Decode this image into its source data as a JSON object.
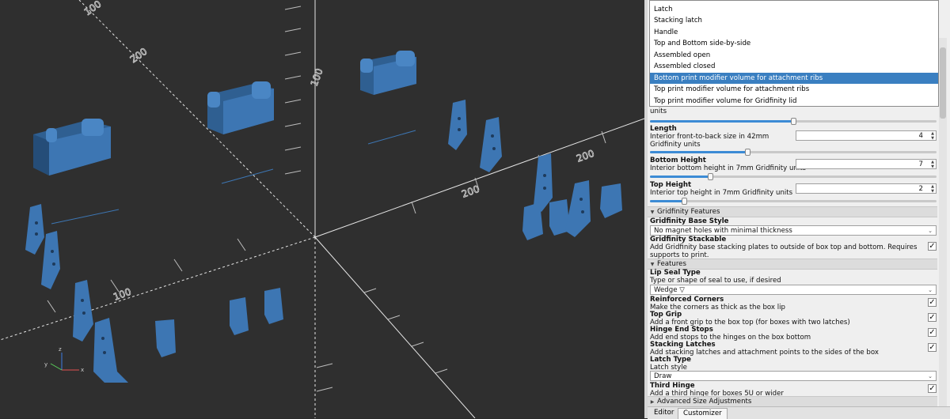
{
  "dropdown": {
    "options": [
      "Latch",
      "Stacking latch",
      "Handle",
      "Top and Bottom side-by-side",
      "Assembled open",
      "Assembled closed",
      "Bottom print modifier volume for attachment ribs",
      "Top print modifier volume for attachment ribs",
      "Top print modifier volume for Gridfinity lid"
    ],
    "selected_index": 6
  },
  "params": {
    "width": {
      "desc": "units",
      "slider": 0.5
    },
    "length": {
      "name": "Length",
      "desc": "Interior front-to-back size in 42mm Gridfinity units",
      "value": "4",
      "slider": 0.34
    },
    "bottom_height": {
      "name": "Bottom Height",
      "desc": "Interior bottom height in 7mm Gridfinity units",
      "value": "7",
      "slider": 0.21
    },
    "top_height": {
      "name": "Top Height",
      "desc": "Interior top height in 7mm Gridfinity units",
      "value": "2",
      "slider": 0.12
    }
  },
  "groups": {
    "gridfinity": "Gridfinity Features",
    "features": "Features",
    "advanced": "Advanced Size Adjustments"
  },
  "gridfinity": {
    "base_style_name": "Gridfinity Base Style",
    "base_style_value": "No magnet holes with minimal thickness",
    "stackable_name": "Gridfinity Stackable",
    "stackable_desc": "Add Gridfinity base stacking plates to outside of box top and bottom. Requires supports to print.",
    "stackable_checked": true
  },
  "features": {
    "lip_seal_name": "Lip Seal Type",
    "lip_seal_desc": "Type or shape of seal to use, if desired",
    "lip_seal_value": "Wedge ▽",
    "items": [
      {
        "name": "Reinforced Corners",
        "desc": "Make the corners as thick as the box lip",
        "checked": true
      },
      {
        "name": "Top Grip",
        "desc": "Add a front grip to the box top (for boxes with two latches)",
        "checked": true
      },
      {
        "name": "Hinge End Stops",
        "desc": "Add end stops to the hinges on the box bottom",
        "checked": true
      },
      {
        "name": "Stacking Latches",
        "desc": "Add stacking latches and attachment points to the sides of the box",
        "checked": true
      }
    ],
    "latch_type_name": "Latch Type",
    "latch_type_desc": "Latch style",
    "latch_type_value": "Draw",
    "third_hinge_name": "Third Hinge",
    "third_hinge_desc": "Add a third hinge for boxes 5U or wider",
    "third_hinge_checked": true
  },
  "tabs": [
    "Editor",
    "Customizer"
  ],
  "active_tab": 1,
  "viewport": {
    "axis_labels": [
      "100",
      "200",
      "100",
      "200",
      "100",
      "200",
      "z",
      "y",
      "x"
    ],
    "colors": {
      "background": "#2f2f2f",
      "part": "#3d76b3",
      "axis": "#e8e8e8",
      "selection": "#3a7fc1"
    }
  }
}
